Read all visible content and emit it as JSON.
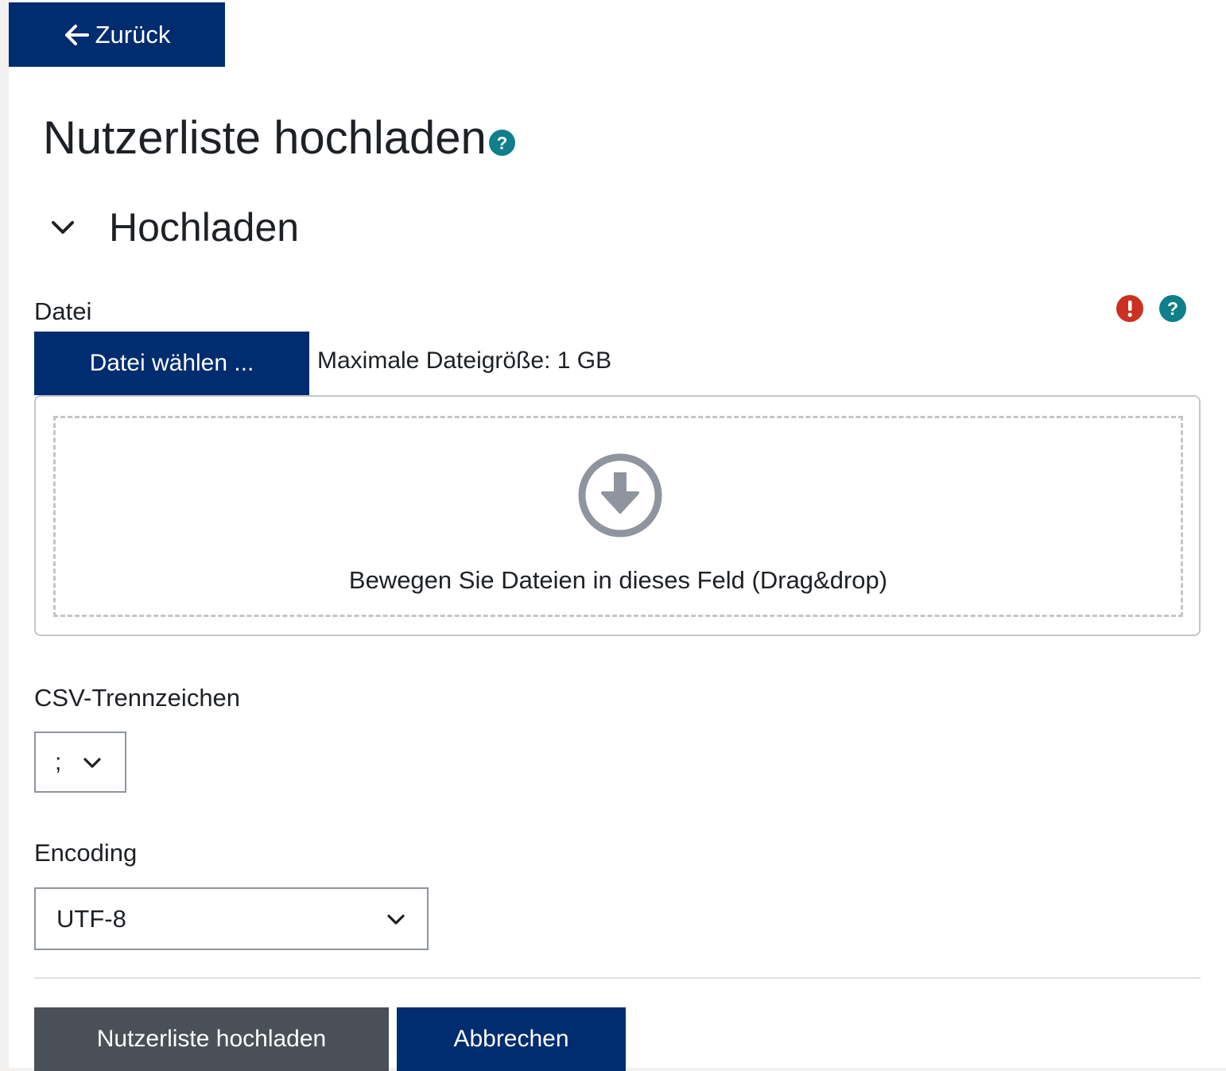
{
  "back_button": {
    "label": "Zurück",
    "icon": "arrow-left-icon"
  },
  "page": {
    "title": "Nutzerliste hochladen",
    "title_help_icon": "help-icon"
  },
  "section": {
    "title": "Hochladen",
    "expanded": true,
    "toggle_icon": "chevron-down-icon"
  },
  "file_field": {
    "label": "Datei",
    "required_icon": "exclamation-icon",
    "help_icon": "help-icon",
    "choose_button_label": "Datei wählen ...",
    "max_size_text": "Maximale Dateigröße: 1 GB",
    "dropzone_text": "Bewegen Sie Dateien in dieses Feld (Drag&drop)",
    "dropzone_icon": "download-circle-icon"
  },
  "csv_separator": {
    "label": "CSV-Trennzeichen",
    "selected": ";"
  },
  "encoding": {
    "label": "Encoding",
    "selected": "UTF-8"
  },
  "actions": {
    "submit_label": "Nutzerliste hochladen",
    "cancel_label": "Abbrechen"
  },
  "colors": {
    "primary": "#002c70",
    "secondary": "#495057",
    "help": "#0f7f8c",
    "required": "#ca3120",
    "page_background": "#f3f1ef"
  }
}
